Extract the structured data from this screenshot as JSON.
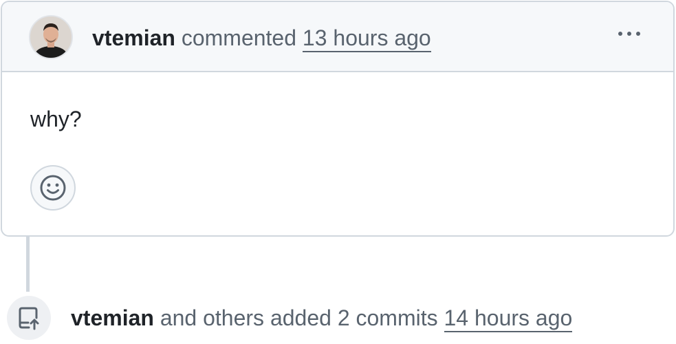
{
  "comment": {
    "author": "vtemian",
    "action": "commented",
    "timestamp": "13 hours ago",
    "body": "why?",
    "avatar_icon": "user-avatar",
    "menu_icon": "kebab-horizontal-icon",
    "reaction_icon": "smiley-icon"
  },
  "event": {
    "author": "vtemian",
    "description": "and others added 2 commits",
    "timestamp": "14 hours ago",
    "icon": "repo-push-icon"
  },
  "colors": {
    "border": "#d0d7de",
    "header_bg": "#f6f8fa",
    "text": "#1f2328",
    "muted": "#59636e"
  }
}
